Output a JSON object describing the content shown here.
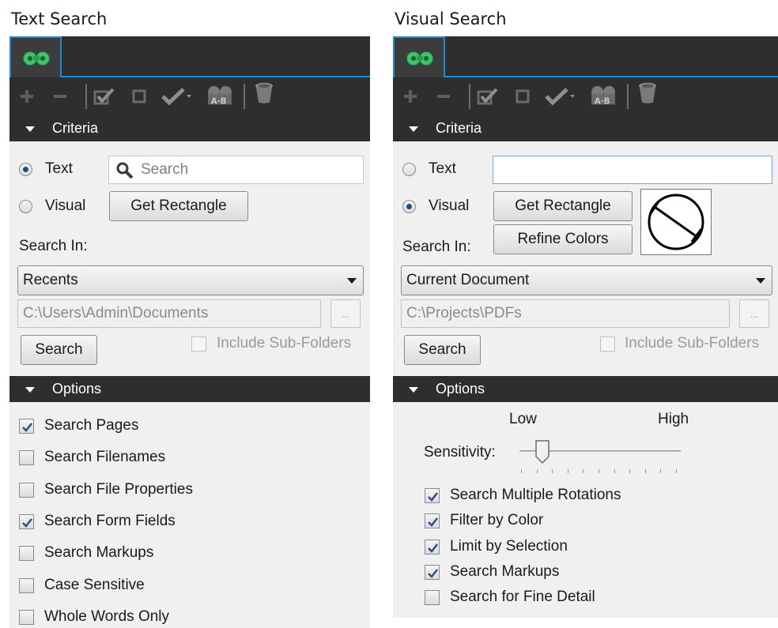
{
  "text_panel": {
    "title": "Text Search",
    "criteria_label": "Criteria",
    "text_radio_label": "Text",
    "visual_radio_label": "Visual",
    "search_placeholder": "Search",
    "get_rectangle_label": "Get Rectangle",
    "search_in_label": "Search In:",
    "search_in_value": "Recents",
    "path_value": "C:\\Users\\Admin\\Documents",
    "browse_label": "...",
    "search_button_label": "Search",
    "include_subfolders_label": "Include Sub-Folders",
    "options_label": "Options",
    "options": [
      {
        "label": "Search Pages",
        "checked": true
      },
      {
        "label": "Search Filenames",
        "checked": false
      },
      {
        "label": "Search File Properties",
        "checked": false
      },
      {
        "label": "Search Form Fields",
        "checked": true
      },
      {
        "label": "Search Markups",
        "checked": false
      },
      {
        "label": "Case Sensitive",
        "checked": false
      },
      {
        "label": "Whole Words Only",
        "checked": false
      }
    ]
  },
  "visual_panel": {
    "title": "Visual Search",
    "criteria_label": "Criteria",
    "text_radio_label": "Text",
    "visual_radio_label": "Visual",
    "text_value": "",
    "get_rectangle_label": "Get Rectangle",
    "refine_colors_label": "Refine Colors",
    "search_in_label": "Search In:",
    "search_in_value": "Current Document",
    "path_value": "C:\\Projects\\PDFs",
    "browse_label": "...",
    "search_button_label": "Search",
    "include_subfolders_label": "Include Sub-Folders",
    "options_label": "Options",
    "sensitivity_label": "Sensitivity:",
    "low_label": "Low",
    "high_label": "High",
    "sensitivity_level": 0.14,
    "options": [
      {
        "label": "Search Multiple Rotations",
        "checked": true
      },
      {
        "label": "Filter by Color",
        "checked": true
      },
      {
        "label": "Limit by Selection",
        "checked": true
      },
      {
        "label": "Search Markups",
        "checked": true
      },
      {
        "label": "Search for Fine Detail",
        "checked": false
      }
    ]
  },
  "icons": {
    "tab": "binoculars-icon",
    "toolbar": [
      "add-icon",
      "remove-icon",
      "check-all-icon",
      "uncheck-icon",
      "checkmark-dropdown-icon",
      "compare-ab-icon",
      "trash-icon"
    ]
  },
  "colors": {
    "accent": "#1c8ad8",
    "dark_bar": "#2e2e2e",
    "panel_bg": "#f0f0f0",
    "binocular_green": "#3ec46d"
  }
}
